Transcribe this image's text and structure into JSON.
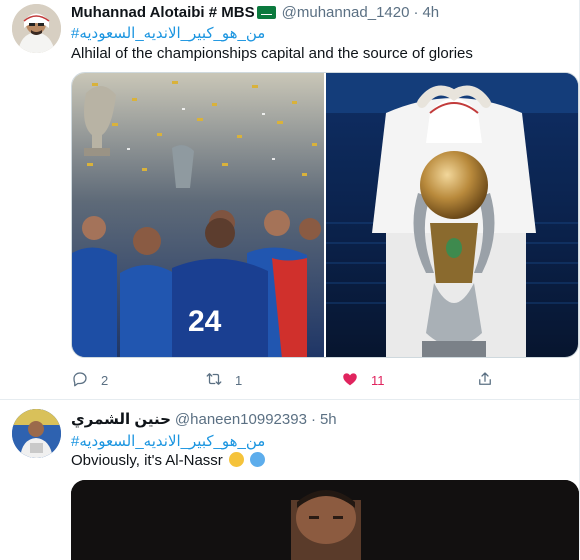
{
  "tweets": [
    {
      "display_name": "Muhannad Alotaibi # MBS",
      "handle": "@muhannad_1420",
      "separator": "·",
      "time": "4h",
      "hashtag": "#من_هو_كبير_الانديه_السعوديه",
      "text": "Alhilal of the championships capital and the source of glories",
      "actions": {
        "reply_count": "2",
        "retweet_count": "1",
        "like_count": "11"
      },
      "liked": true,
      "media_count": 2
    },
    {
      "display_name": "حنين الشمري",
      "handle": "@haneen10992393",
      "separator": "·",
      "time": "5h",
      "hashtag": "#من_هو_كبير_الانديه_السعوديه",
      "text": "Obviously, it's Al-Nassr",
      "emojis": [
        "yellow-heart",
        "blue-heart"
      ]
    }
  ],
  "colors": {
    "link": "#1b95e0",
    "secondary_text": "#5b7083",
    "like": "#e0245e",
    "divider": "#e6ecf0",
    "hilal_blue": "#1e4f9e"
  }
}
